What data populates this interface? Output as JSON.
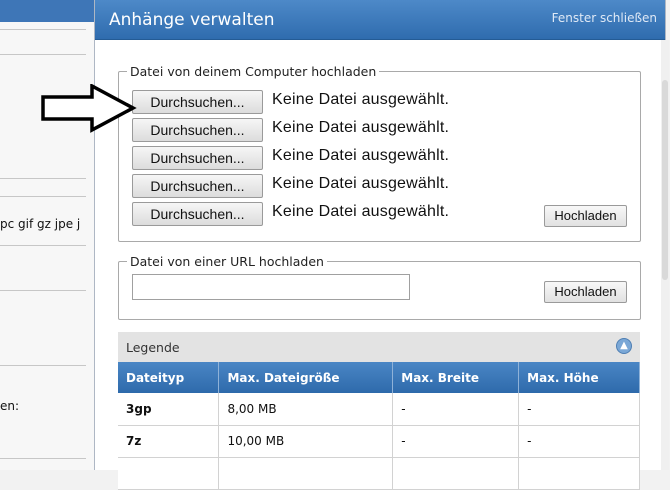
{
  "background": {
    "extension_snippet": "pc gif gz jpe j",
    "label_snippet": "en:"
  },
  "popup": {
    "title": "Anhänge verwalten",
    "close_label": "Fenster schließen"
  },
  "computer_upload": {
    "legend": "Datei von deinem Computer hochladen",
    "rows": [
      {
        "button": "Durchsuchen...",
        "status": "Keine Datei ausgewählt."
      },
      {
        "button": "Durchsuchen...",
        "status": "Keine Datei ausgewählt."
      },
      {
        "button": "Durchsuchen...",
        "status": "Keine Datei ausgewählt."
      },
      {
        "button": "Durchsuchen...",
        "status": "Keine Datei ausgewählt."
      },
      {
        "button": "Durchsuchen...",
        "status": "Keine Datei ausgewählt."
      }
    ],
    "upload_label": "Hochladen"
  },
  "url_upload": {
    "legend": "Datei von einer URL hochladen",
    "input_value": "",
    "upload_label": "Hochladen"
  },
  "legend_table": {
    "title": "Legende",
    "columns": [
      "Dateityp",
      "Max. Dateigröße",
      "Max. Breite",
      "Max. Höhe"
    ],
    "rows": [
      {
        "type": "3gp",
        "size": "8,00 MB",
        "width": "-",
        "height": "-"
      },
      {
        "type": "7z",
        "size": "10,00 MB",
        "width": "-",
        "height": "-"
      }
    ]
  },
  "colors": {
    "header_blue": "#3b78ba",
    "table_header_blue": "#3d7aba"
  }
}
